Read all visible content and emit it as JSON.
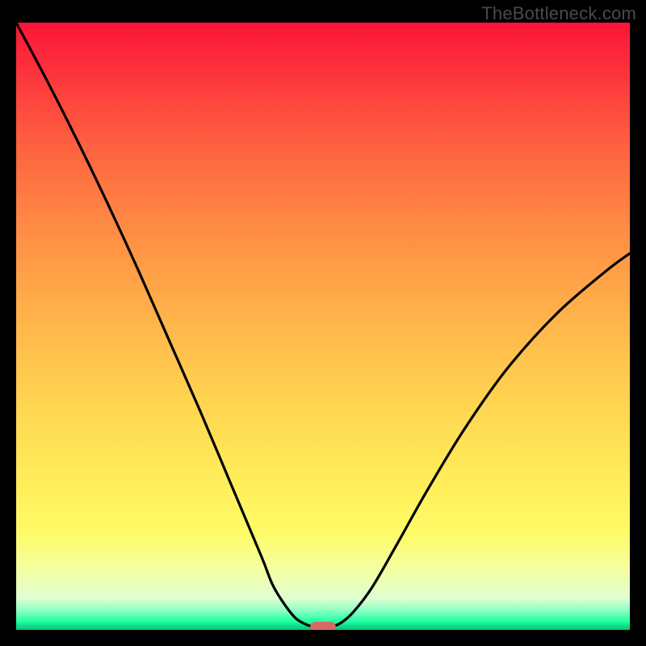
{
  "watermark": "TheBottleneck.com",
  "chart_data": {
    "type": "line",
    "title": "",
    "xlabel": "",
    "ylabel": "",
    "xlim": [
      0,
      100
    ],
    "ylim": [
      0,
      100
    ],
    "x": [
      0,
      5,
      10,
      15,
      20,
      25,
      30,
      35,
      40,
      42,
      45,
      47,
      49,
      51,
      53,
      55,
      58,
      62,
      67,
      73,
      80,
      88,
      96,
      100
    ],
    "values": [
      100,
      90.5,
      80.5,
      70,
      59,
      47.5,
      36,
      24,
      12,
      7,
      2.5,
      1,
      0.4,
      0.4,
      1.2,
      3,
      7,
      14,
      23,
      33,
      43,
      52,
      59,
      62
    ],
    "minimum": {
      "x": 50,
      "y": 0.4
    },
    "gradient_meaning": "vertical color gradient from red (top / high bottleneck) through orange, yellow to green (bottom / low bottleneck)",
    "marker_meaning": "highlighted optimum point at curve minimum"
  },
  "colors": {
    "background": "#000000",
    "curve": "#000000",
    "marker": "#d76a64",
    "watermark": "#4a4a4a"
  }
}
